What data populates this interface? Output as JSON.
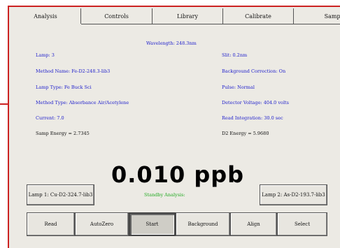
{
  "tabs": [
    "Analysis",
    "Controls",
    "Library",
    "Calibrate",
    "Samples"
  ],
  "wavelength": "Wavelength: 248.3nm",
  "left_info": [
    {
      "text": "Lamp: 3",
      "color": "#2222cc"
    },
    {
      "text": "Method Name: Fe-D2-248.3-lib3",
      "color": "#2222cc"
    },
    {
      "text": "Lamp Type: Fe Buck Sci",
      "color": "#2222cc"
    },
    {
      "text": "Method Type: Absorbance Air/Acetylene",
      "color": "#2222cc"
    },
    {
      "text": "Current: 7.0",
      "color": "#2222cc"
    },
    {
      "text": "Samp Energy = 2.7345",
      "color": "#111111"
    }
  ],
  "right_info": [
    {
      "text": "Slit: 0.2nm",
      "color": "#2222cc"
    },
    {
      "text": "Background Correction: On",
      "color": "#2222cc"
    },
    {
      "text": "Pulse: Normal",
      "color": "#2222cc"
    },
    {
      "text": "Detector Voltage: 404.0 volts",
      "color": "#2222cc"
    },
    {
      "text": "Read Integration: 30.0 sec",
      "color": "#2222cc"
    },
    {
      "text": "D2 Energy = 5.9680",
      "color": "#111111"
    }
  ],
  "reading": "0.010 ppb",
  "status": "Standby Analysis:",
  "lamp1_button": "Lamp 1: Cu-D2-324.7-lib3",
  "lamp2_button": "Lamp 2: As-D2-193.7-lib3",
  "bottom_buttons": [
    "Read",
    "AutoZero",
    "Start",
    "Background",
    "Align",
    "Select"
  ]
}
